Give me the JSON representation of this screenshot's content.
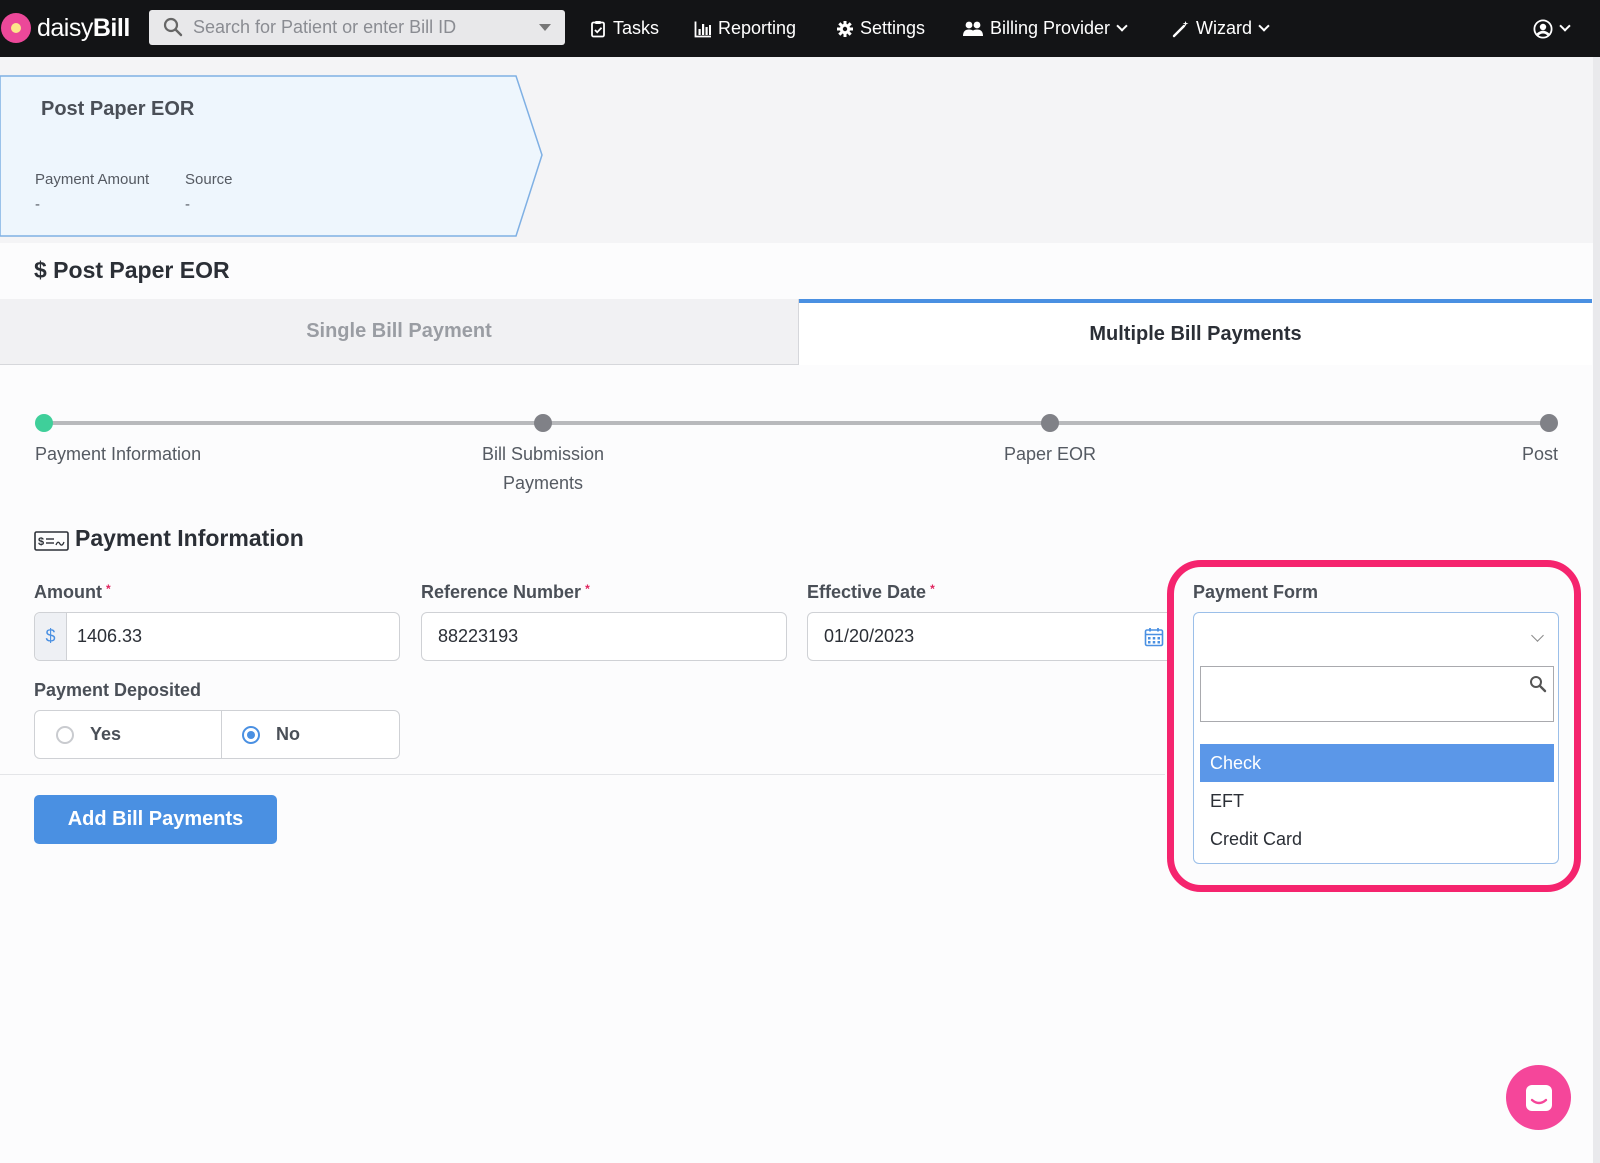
{
  "header": {
    "logo_text_light": "daisy",
    "logo_text_bold": "Bill",
    "search_placeholder": "Search for Patient or enter Bill ID",
    "nav": [
      {
        "label": "Tasks",
        "icon": "clipboard-icon"
      },
      {
        "label": "Reporting",
        "icon": "bar-chart-icon"
      },
      {
        "label": "Settings",
        "icon": "gear-icon"
      },
      {
        "label": "Billing Provider",
        "icon": "users-icon"
      },
      {
        "label": "Wizard",
        "icon": "magic-wand-icon"
      }
    ],
    "user_icon": "user-circle-icon"
  },
  "step_card": {
    "title": "Post Paper EOR",
    "fields": [
      {
        "label": "Payment Amount",
        "value": "-"
      },
      {
        "label": "Source",
        "value": "-"
      }
    ]
  },
  "page": {
    "title": "$ Post Paper EOR"
  },
  "tabs": [
    {
      "label": "Single Bill Payment",
      "active": false
    },
    {
      "label": "Multiple Bill Payments",
      "active": true
    }
  ],
  "progress": {
    "steps": [
      {
        "label": "Payment Information",
        "active": true
      },
      {
        "label_line1": "Bill Submission",
        "label_line2": "Payments",
        "active": false
      },
      {
        "label": "Paper EOR",
        "active": false
      },
      {
        "label": "Post",
        "active": false
      }
    ]
  },
  "form": {
    "section_title": "Payment Information",
    "amount": {
      "label": "Amount",
      "required_mark": "*",
      "prefix": "$",
      "value": "1406.33"
    },
    "reference_number": {
      "label": "Reference Number",
      "required_mark": "*",
      "value": "88223193"
    },
    "effective_date": {
      "label": "Effective Date",
      "required_mark": "*",
      "value": "01/20/2023"
    },
    "payment_form": {
      "label": "Payment Form",
      "value": "",
      "search_value": "",
      "options": [
        "Check",
        "EFT",
        "Credit Card"
      ],
      "highlighted_option": "Check"
    },
    "payment_deposited": {
      "label": "Payment Deposited",
      "options": [
        "Yes",
        "No"
      ],
      "selected": "No"
    },
    "add_button_label": "Add Bill Payments"
  },
  "colors": {
    "accent": "#4a90e2",
    "highlight_ring": "#f5246e",
    "active_step": "#3fcf9a",
    "chat_button": "#f5469a"
  }
}
